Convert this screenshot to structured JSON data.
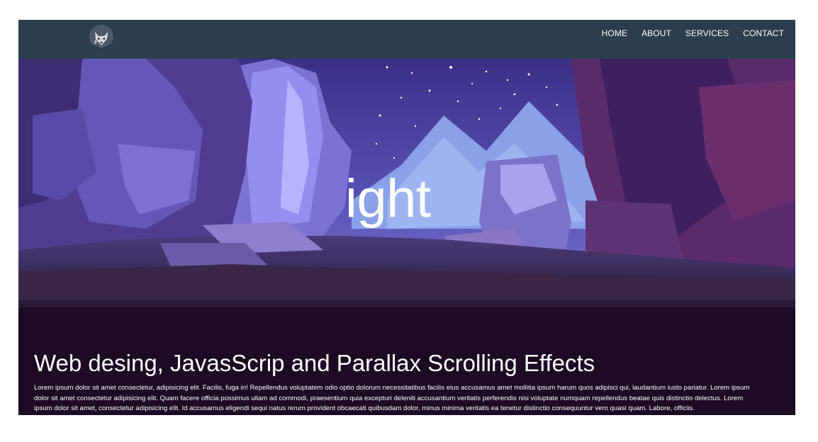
{
  "nav": {
    "items": [
      "HOME",
      "ABOUT",
      "SERVICES",
      "CONTACT"
    ]
  },
  "hero": {
    "text": "ight"
  },
  "content": {
    "title": "Web desing, JavasScrip and Parallax Scrolling Effects",
    "body": "Lorem ipsum dolor sit amet consectetur, adipisicing elit. Facilis, fuga in! Repellendus voluptatem odio optio dolorum necessitatibus facilis eius accusamus amet mollitia ipsum harum quos adipisci qui, laudantium iusto pariatur. Lorem ipsum dolor sit amet consectetur adipisicing elit. Quam facere officia possimus ullam ad commodi, praesentium quia excepturi deleniti accusantium veritatis perferendis nisi voluptate numquam repellendus beatae quis distinctio delectus. Lorem ipsum dolor sit amet, consectetur adipisicing elit. Id accusamus eligendi sequi natus rerum provident obcaecati quibusdam dolor, minus minima veritatis ea tenetur distinctio consequuntur vero quasi quam. Labore, officiis."
  },
  "colors": {
    "navbar": "#2c3e4d",
    "page_background": "#1d0a24",
    "sky": "#5a4fb0",
    "mountains": "#8fa2e6"
  },
  "icons": {
    "logo": "wolf-logo-icon"
  }
}
